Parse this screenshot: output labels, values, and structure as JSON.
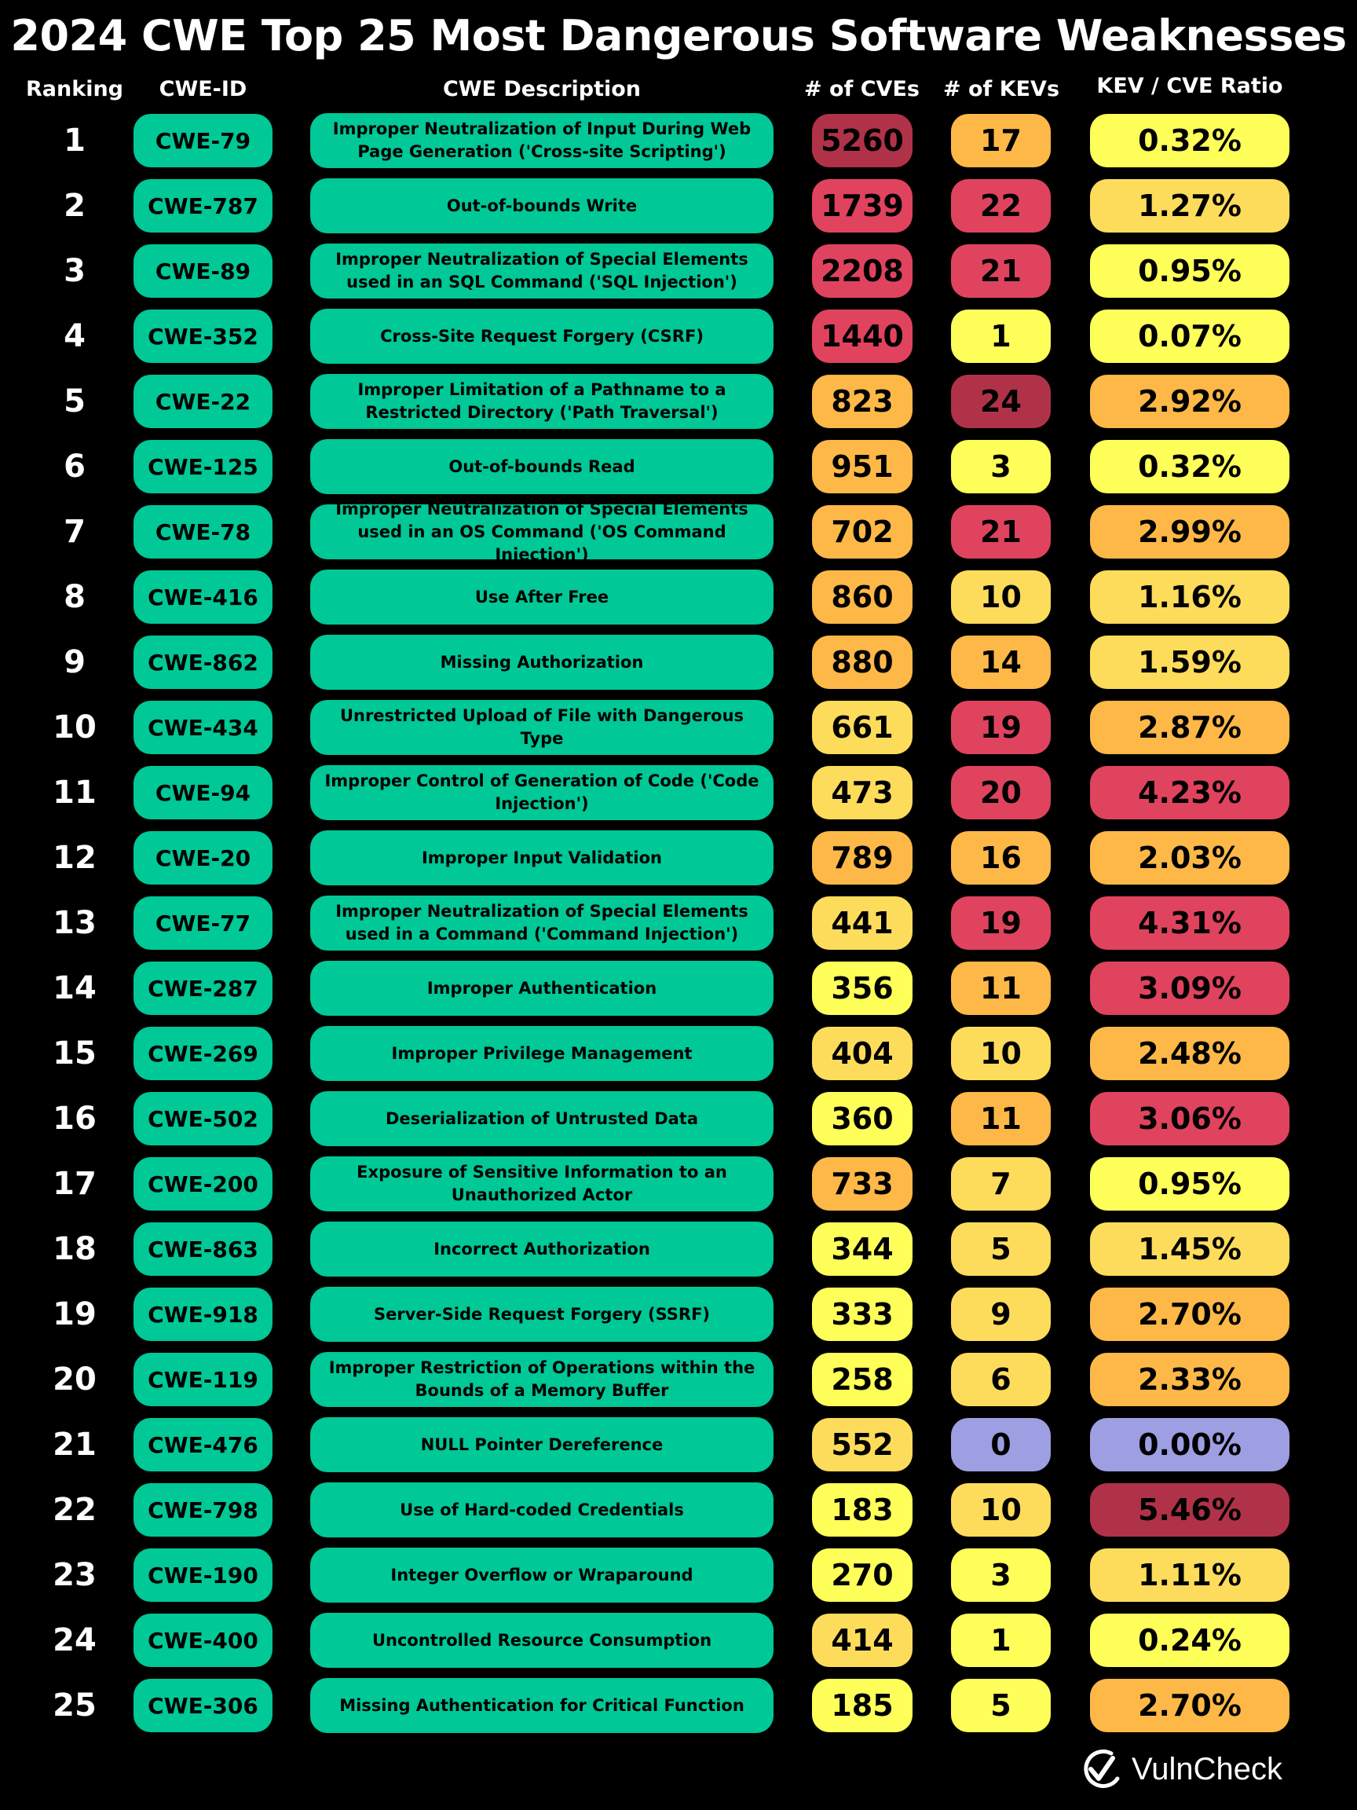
{
  "title": "2024 CWE Top 25 Most Dangerous Software Weaknesses",
  "headers": {
    "ranking": "Ranking",
    "cwe_id": "CWE-ID",
    "description": "CWE Description",
    "cves": "# of CVEs",
    "kevs": "# of KEVs",
    "ratio": "KEV / CVE Ratio"
  },
  "colors": {
    "cwe_pill": "#00C896",
    "dark_red": "#B03249",
    "red": "#E0435E",
    "orange": "#FDB848",
    "light_orange": "#FDDC5C",
    "yellow": "#FFFF5A",
    "purple": "#9E9EE3"
  },
  "rows": [
    {
      "rank": "1",
      "id": "CWE-79",
      "desc": "Improper Neutralization of Input During Web Page Generation ('Cross-site Scripting')",
      "cves": "5260",
      "kevs": "17",
      "ratio": "0.32%",
      "cves_color": "dark_red",
      "kevs_color": "orange",
      "ratio_color": "yellow"
    },
    {
      "rank": "2",
      "id": "CWE-787",
      "desc": "Out-of-bounds Write",
      "cves": "1739",
      "kevs": "22",
      "ratio": "1.27%",
      "cves_color": "red",
      "kevs_color": "red",
      "ratio_color": "light_orange"
    },
    {
      "rank": "3",
      "id": "CWE-89",
      "desc": "Improper Neutralization of Special Elements used in an SQL Command ('SQL Injection')",
      "cves": "2208",
      "kevs": "21",
      "ratio": "0.95%",
      "cves_color": "red",
      "kevs_color": "red",
      "ratio_color": "yellow"
    },
    {
      "rank": "4",
      "id": "CWE-352",
      "desc": "Cross-Site Request Forgery (CSRF)",
      "cves": "1440",
      "kevs": "1",
      "ratio": "0.07%",
      "cves_color": "red",
      "kevs_color": "yellow",
      "ratio_color": "yellow"
    },
    {
      "rank": "5",
      "id": "CWE-22",
      "desc": "Improper Limitation of a Pathname to a Restricted Directory ('Path Traversal')",
      "cves": "823",
      "kevs": "24",
      "ratio": "2.92%",
      "cves_color": "orange",
      "kevs_color": "dark_red",
      "ratio_color": "orange"
    },
    {
      "rank": "6",
      "id": "CWE-125",
      "desc": "Out-of-bounds Read",
      "cves": "951",
      "kevs": "3",
      "ratio": "0.32%",
      "cves_color": "orange",
      "kevs_color": "yellow",
      "ratio_color": "yellow"
    },
    {
      "rank": "7",
      "id": "CWE-78",
      "desc": "Improper Neutralization of Special Elements used in an OS Command ('OS Command Injection')",
      "cves": "702",
      "kevs": "21",
      "ratio": "2.99%",
      "cves_color": "orange",
      "kevs_color": "red",
      "ratio_color": "orange"
    },
    {
      "rank": "8",
      "id": "CWE-416",
      "desc": "Use After Free",
      "cves": "860",
      "kevs": "10",
      "ratio": "1.16%",
      "cves_color": "orange",
      "kevs_color": "light_orange",
      "ratio_color": "light_orange"
    },
    {
      "rank": "9",
      "id": "CWE-862",
      "desc": "Missing Authorization",
      "cves": "880",
      "kevs": "14",
      "ratio": "1.59%",
      "cves_color": "orange",
      "kevs_color": "orange",
      "ratio_color": "light_orange"
    },
    {
      "rank": "10",
      "id": "CWE-434",
      "desc": "Unrestricted Upload of File with Dangerous Type",
      "cves": "661",
      "kevs": "19",
      "ratio": "2.87%",
      "cves_color": "light_orange",
      "kevs_color": "red",
      "ratio_color": "orange"
    },
    {
      "rank": "11",
      "id": "CWE-94",
      "desc": "Improper Control of Generation of Code ('Code Injection')",
      "cves": "473",
      "kevs": "20",
      "ratio": "4.23%",
      "cves_color": "light_orange",
      "kevs_color": "red",
      "ratio_color": "red"
    },
    {
      "rank": "12",
      "id": "CWE-20",
      "desc": "Improper Input Validation",
      "cves": "789",
      "kevs": "16",
      "ratio": "2.03%",
      "cves_color": "orange",
      "kevs_color": "orange",
      "ratio_color": "orange"
    },
    {
      "rank": "13",
      "id": "CWE-77",
      "desc": "Improper Neutralization of Special Elements used in a Command ('Command Injection')",
      "cves": "441",
      "kevs": "19",
      "ratio": "4.31%",
      "cves_color": "light_orange",
      "kevs_color": "red",
      "ratio_color": "red"
    },
    {
      "rank": "14",
      "id": "CWE-287",
      "desc": "Improper Authentication",
      "cves": "356",
      "kevs": "11",
      "ratio": "3.09%",
      "cves_color": "yellow",
      "kevs_color": "orange",
      "ratio_color": "red"
    },
    {
      "rank": "15",
      "id": "CWE-269",
      "desc": "Improper Privilege Management",
      "cves": "404",
      "kevs": "10",
      "ratio": "2.48%",
      "cves_color": "light_orange",
      "kevs_color": "light_orange",
      "ratio_color": "orange"
    },
    {
      "rank": "16",
      "id": "CWE-502",
      "desc": "Deserialization of Untrusted Data",
      "cves": "360",
      "kevs": "11",
      "ratio": "3.06%",
      "cves_color": "yellow",
      "kevs_color": "orange",
      "ratio_color": "red"
    },
    {
      "rank": "17",
      "id": "CWE-200",
      "desc": "Exposure of Sensitive Information to an Unauthorized Actor",
      "cves": "733",
      "kevs": "7",
      "ratio": "0.95%",
      "cves_color": "orange",
      "kevs_color": "light_orange",
      "ratio_color": "yellow"
    },
    {
      "rank": "18",
      "id": "CWE-863",
      "desc": "Incorrect Authorization",
      "cves": "344",
      "kevs": "5",
      "ratio": "1.45%",
      "cves_color": "yellow",
      "kevs_color": "light_orange",
      "ratio_color": "light_orange"
    },
    {
      "rank": "19",
      "id": "CWE-918",
      "desc": "Server-Side Request Forgery (SSRF)",
      "cves": "333",
      "kevs": "9",
      "ratio": "2.70%",
      "cves_color": "yellow",
      "kevs_color": "light_orange",
      "ratio_color": "orange"
    },
    {
      "rank": "20",
      "id": "CWE-119",
      "desc": "Improper Restriction of Operations within the Bounds of a Memory Buffer",
      "cves": "258",
      "kevs": "6",
      "ratio": "2.33%",
      "cves_color": "yellow",
      "kevs_color": "light_orange",
      "ratio_color": "orange"
    },
    {
      "rank": "21",
      "id": "CWE-476",
      "desc": "NULL Pointer Dereference",
      "cves": "552",
      "kevs": "0",
      "ratio": "0.00%",
      "cves_color": "light_orange",
      "kevs_color": "purple",
      "ratio_color": "purple"
    },
    {
      "rank": "22",
      "id": "CWE-798",
      "desc": "Use of Hard-coded Credentials",
      "cves": "183",
      "kevs": "10",
      "ratio": "5.46%",
      "cves_color": "yellow",
      "kevs_color": "light_orange",
      "ratio_color": "dark_red"
    },
    {
      "rank": "23",
      "id": "CWE-190",
      "desc": "Integer Overflow or Wraparound",
      "cves": "270",
      "kevs": "3",
      "ratio": "1.11%",
      "cves_color": "yellow",
      "kevs_color": "yellow",
      "ratio_color": "light_orange"
    },
    {
      "rank": "24",
      "id": "CWE-400",
      "desc": "Uncontrolled Resource Consumption",
      "cves": "414",
      "kevs": "1",
      "ratio": "0.24%",
      "cves_color": "light_orange",
      "kevs_color": "yellow",
      "ratio_color": "yellow"
    },
    {
      "rank": "25",
      "id": "CWE-306",
      "desc": "Missing Authentication for Critical Function",
      "cves": "185",
      "kevs": "5",
      "ratio": "2.70%",
      "cves_color": "yellow",
      "kevs_color": "yellow",
      "ratio_color": "orange"
    }
  ],
  "brand": {
    "name": "VulnCheck",
    "icon": "check-shield-icon"
  },
  "chart_data": {
    "type": "table",
    "title": "2024 CWE Top 25 Most Dangerous Software Weaknesses",
    "columns": [
      "Ranking",
      "CWE-ID",
      "CWE Description",
      "# of CVEs",
      "# of KEVs",
      "KEV / CVE Ratio"
    ],
    "values": [
      [
        1,
        "CWE-79",
        "Improper Neutralization of Input During Web Page Generation ('Cross-site Scripting')",
        5260,
        17,
        "0.32%"
      ],
      [
        2,
        "CWE-787",
        "Out-of-bounds Write",
        1739,
        22,
        "1.27%"
      ],
      [
        3,
        "CWE-89",
        "Improper Neutralization of Special Elements used in an SQL Command ('SQL Injection')",
        2208,
        21,
        "0.95%"
      ],
      [
        4,
        "CWE-352",
        "Cross-Site Request Forgery (CSRF)",
        1440,
        1,
        "0.07%"
      ],
      [
        5,
        "CWE-22",
        "Improper Limitation of a Pathname to a Restricted Directory ('Path Traversal')",
        823,
        24,
        "2.92%"
      ],
      [
        6,
        "CWE-125",
        "Out-of-bounds Read",
        951,
        3,
        "0.32%"
      ],
      [
        7,
        "CWE-78",
        "Improper Neutralization of Special Elements used in an OS Command ('OS Command Injection')",
        702,
        21,
        "2.99%"
      ],
      [
        8,
        "CWE-416",
        "Use After Free",
        860,
        10,
        "1.16%"
      ],
      [
        9,
        "CWE-862",
        "Missing Authorization",
        880,
        14,
        "1.59%"
      ],
      [
        10,
        "CWE-434",
        "Unrestricted Upload of File with Dangerous Type",
        661,
        19,
        "2.87%"
      ],
      [
        11,
        "CWE-94",
        "Improper Control of Generation of Code ('Code Injection')",
        473,
        20,
        "4.23%"
      ],
      [
        12,
        "CWE-20",
        "Improper Input Validation",
        789,
        16,
        "2.03%"
      ],
      [
        13,
        "CWE-77",
        "Improper Neutralization of Special Elements used in a Command ('Command Injection')",
        441,
        19,
        "4.31%"
      ],
      [
        14,
        "CWE-287",
        "Improper Authentication",
        356,
        11,
        "3.09%"
      ],
      [
        15,
        "CWE-269",
        "Improper Privilege Management",
        404,
        10,
        "2.48%"
      ],
      [
        16,
        "CWE-502",
        "Deserialization of Untrusted Data",
        360,
        11,
        "3.06%"
      ],
      [
        17,
        "CWE-200",
        "Exposure of Sensitive Information to an Unauthorized Actor",
        733,
        7,
        "0.95%"
      ],
      [
        18,
        "CWE-863",
        "Incorrect Authorization",
        344,
        5,
        "1.45%"
      ],
      [
        19,
        "CWE-918",
        "Server-Side Request Forgery (SSRF)",
        333,
        9,
        "2.70%"
      ],
      [
        20,
        "CWE-119",
        "Improper Restriction of Operations within the Bounds of a Memory Buffer",
        258,
        6,
        "2.33%"
      ],
      [
        21,
        "CWE-476",
        "NULL Pointer Dereference",
        552,
        0,
        "0.00%"
      ],
      [
        22,
        "CWE-798",
        "Use of Hard-coded Credentials",
        183,
        10,
        "5.46%"
      ],
      [
        23,
        "CWE-190",
        "Integer Overflow or Wraparound",
        270,
        3,
        "1.11%"
      ],
      [
        24,
        "CWE-400",
        "Uncontrolled Resource Consumption",
        414,
        1,
        "0.24%"
      ],
      [
        25,
        "CWE-306",
        "Missing Authentication for Critical Function",
        185,
        5,
        "2.70%"
      ]
    ]
  }
}
